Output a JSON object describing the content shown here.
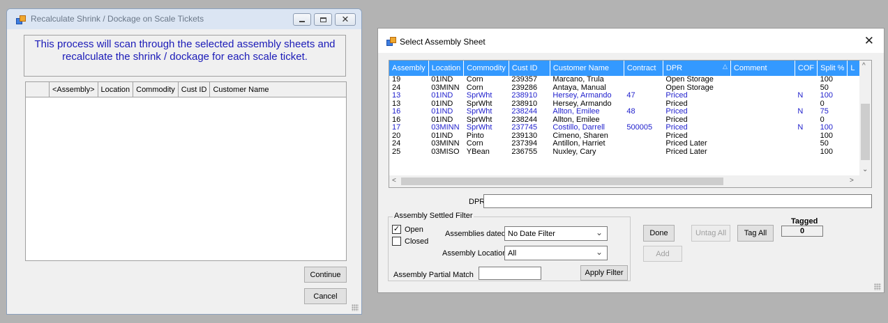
{
  "window1": {
    "title": "Recalculate Shrink / Dockage on Scale Tickets",
    "message_line1": "This process will scan through the selected assembly sheets and",
    "message_line2": "recalculate the shrink / dockage for each scale ticket.",
    "columns": [
      "<Assembly>",
      "Location",
      "Commodity",
      "Cust ID",
      "Customer Name"
    ],
    "continue_label": "Continue",
    "cancel_label": "Cancel"
  },
  "window2": {
    "title": "Select Assembly Sheet",
    "columns": [
      "Assembly",
      "Location",
      "Commodity",
      "Cust ID",
      "Customer Name",
      "Contract",
      "DPR",
      "Comment",
      "COF",
      "Split %",
      "L"
    ],
    "rows": [
      {
        "assembly": "19",
        "location": "01IND",
        "commodity": "Corn",
        "cust_id": "239357",
        "customer": "Marcano, Trula",
        "contract": "",
        "dpr": "Open Storage",
        "comment": "",
        "cof": "",
        "split": "100",
        "hl": false
      },
      {
        "assembly": "24",
        "location": "03MINN",
        "commodity": "Corn",
        "cust_id": "239286",
        "customer": "Antaya, Manual",
        "contract": "",
        "dpr": "Open Storage",
        "comment": "",
        "cof": "",
        "split": "50",
        "hl": false
      },
      {
        "assembly": "13",
        "location": "01IND",
        "commodity": "SprWht",
        "cust_id": "238910",
        "customer": "Hersey, Armando",
        "contract": "47",
        "dpr": "Priced",
        "comment": "",
        "cof": "N",
        "split": "100",
        "hl": true
      },
      {
        "assembly": "13",
        "location": "01IND",
        "commodity": "SprWht",
        "cust_id": "238910",
        "customer": "Hersey, Armando",
        "contract": "",
        "dpr": "Priced",
        "comment": "",
        "cof": "",
        "split": "0",
        "hl": false
      },
      {
        "assembly": "16",
        "location": "01IND",
        "commodity": "SprWht",
        "cust_id": "238244",
        "customer": "Allton, Emilee",
        "contract": "48",
        "dpr": "Priced",
        "comment": "",
        "cof": "N",
        "split": "75",
        "hl": true
      },
      {
        "assembly": "16",
        "location": "01IND",
        "commodity": "SprWht",
        "cust_id": "238244",
        "customer": "Allton, Emilee",
        "contract": "",
        "dpr": "Priced",
        "comment": "",
        "cof": "",
        "split": "0",
        "hl": false
      },
      {
        "assembly": "17",
        "location": "03MINN",
        "commodity": "SprWht",
        "cust_id": "237745",
        "customer": "Costillo, Darrell",
        "contract": "500005",
        "dpr": "Priced",
        "comment": "",
        "cof": "N",
        "split": "100",
        "hl": true
      },
      {
        "assembly": "20",
        "location": "01IND",
        "commodity": "Pinto",
        "cust_id": "239130",
        "customer": "Cimeno, Sharen",
        "contract": "",
        "dpr": "Priced",
        "comment": "",
        "cof": "",
        "split": "100",
        "hl": false
      },
      {
        "assembly": "24",
        "location": "03MINN",
        "commodity": "Corn",
        "cust_id": "237394",
        "customer": "Antillon, Harriet",
        "contract": "",
        "dpr": "Priced Later",
        "comment": "",
        "cof": "",
        "split": "50",
        "hl": false
      },
      {
        "assembly": "25",
        "location": "03MISO",
        "commodity": "YBean",
        "cust_id": "236755",
        "customer": "Nuxley, Cary",
        "contract": "",
        "dpr": "Priced Later",
        "comment": "",
        "cof": "",
        "split": "100",
        "hl": false
      }
    ],
    "dpr_label": "DPR",
    "dpr_value": "",
    "filter": {
      "group_title": "Assembly Settled Filter",
      "open_label": "Open",
      "open_checked": true,
      "closed_label": "Closed",
      "closed_checked": false,
      "assemblies_dated_label": "Assemblies dated",
      "assemblies_dated_value": "No Date Filter",
      "assembly_location_label": "Assembly Location",
      "assembly_location_value": "All",
      "partial_match_label": "Assembly Partial Match",
      "partial_match_value": "",
      "apply_label": "Apply Filter"
    },
    "done_label": "Done",
    "untag_label": "Untag All",
    "tag_label": "Tag All",
    "add_label": "Add",
    "tagged_label": "Tagged",
    "tagged_value": "0"
  }
}
